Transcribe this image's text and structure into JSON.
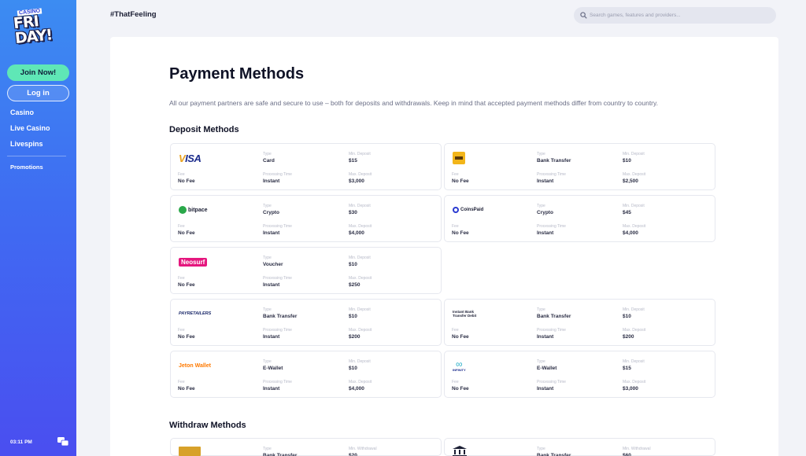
{
  "sidebar": {
    "logo_small": "CASINO",
    "logo_big": "FRI DAY!",
    "join_label": "Join Now!",
    "login_label": "Log in",
    "nav": [
      "Casino",
      "Live Casino",
      "Livespins"
    ],
    "promotions": "Promotions",
    "time": "03:11 PM"
  },
  "topbar": {
    "tagline": "#ThatFeeling",
    "search_placeholder": "Search games, features and providers..."
  },
  "page": {
    "title": "Payment Methods",
    "intro": "All our payment partners are safe and secure to use – both for deposits and withdrawals. Keep in mind that accepted payment methods differ from country to country.",
    "deposit_heading": "Deposit Methods",
    "withdraw_heading": "Withdraw Methods"
  },
  "labels": {
    "type": "Type",
    "min_deposit": "Min. Deposit",
    "max_deposit": "Max. Deposit",
    "fee": "Fee",
    "processing_time": "Processing Time",
    "min_withdrawal": "Min. Withdrawal"
  },
  "deposits": [
    {
      "logo": "VISA",
      "type": "Card",
      "min": "$15",
      "fee": "No Fee",
      "time": "Instant",
      "max": "$3,000"
    },
    {
      "logo": "bank-icon",
      "type": "Bank Transfer",
      "min": "$10",
      "fee": "No Fee",
      "time": "Instant",
      "max": "$2,500"
    },
    {
      "logo": "bitpace",
      "type": "Crypto",
      "min": "$30",
      "fee": "No Fee",
      "time": "Instant",
      "max": "$4,000"
    },
    {
      "logo": "CoinsPaid",
      "type": "Crypto",
      "min": "$45",
      "fee": "No Fee",
      "time": "Instant",
      "max": "$4,000"
    },
    {
      "logo": "Neosurf",
      "type": "Voucher",
      "min": "$10",
      "fee": "No Fee",
      "time": "Instant",
      "max": "$250"
    },
    {
      "logo": "PAYRETAILERS",
      "type": "Bank Transfer",
      "min": "$10",
      "fee": "No Fee",
      "time": "Instant",
      "max": "$200"
    },
    {
      "logo": "Instant Bank Transfer Debit",
      "type": "Bank Transfer",
      "min": "$10",
      "fee": "No Fee",
      "time": "Instant",
      "max": "$200"
    },
    {
      "logo": "Jeton Wallet",
      "type": "E-Wallet",
      "min": "$10",
      "fee": "No Fee",
      "time": "Instant",
      "max": "$4,000"
    },
    {
      "logo": "INFINITY",
      "type": "E-Wallet",
      "min": "$15",
      "fee": "No Fee",
      "time": "Instant",
      "max": "$3,000"
    }
  ],
  "withdrawals": [
    {
      "logo": "bank-icon",
      "type": "Bank Transfer",
      "min": "$20"
    },
    {
      "logo": "temple-icon",
      "type": "Bank Transfer",
      "min": "$60"
    }
  ]
}
